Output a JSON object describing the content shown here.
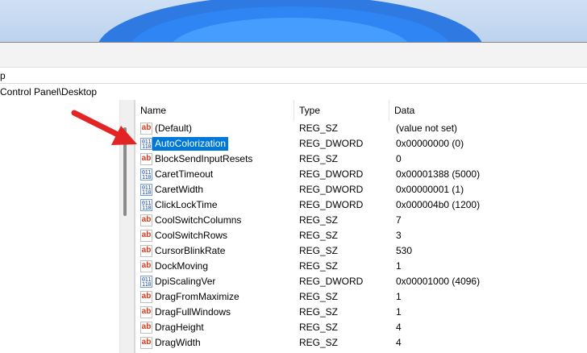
{
  "menu_fragment": "p",
  "address_path": "Control Panel\\Desktop",
  "columns": {
    "name": "Name",
    "type": "Type",
    "data": "Data"
  },
  "values": [
    {
      "icon": "string-value-icon",
      "badge": "ab",
      "name": "(Default)",
      "type": "REG_SZ",
      "data": "(value not set)",
      "selected": false
    },
    {
      "icon": "binary-value-icon",
      "badge": "011\n110",
      "name": "AutoColorization",
      "type": "REG_DWORD",
      "data": "0x00000000 (0)",
      "selected": true
    },
    {
      "icon": "string-value-icon",
      "badge": "ab",
      "name": "BlockSendInputResets",
      "type": "REG_SZ",
      "data": "0",
      "selected": false
    },
    {
      "icon": "binary-value-icon",
      "badge": "011\n110",
      "name": "CaretTimeout",
      "type": "REG_DWORD",
      "data": "0x00001388 (5000)",
      "selected": false
    },
    {
      "icon": "binary-value-icon",
      "badge": "011\n110",
      "name": "CaretWidth",
      "type": "REG_DWORD",
      "data": "0x00000001 (1)",
      "selected": false
    },
    {
      "icon": "binary-value-icon",
      "badge": "011\n110",
      "name": "ClickLockTime",
      "type": "REG_DWORD",
      "data": "0x000004b0 (1200)",
      "selected": false
    },
    {
      "icon": "string-value-icon",
      "badge": "ab",
      "name": "CoolSwitchColumns",
      "type": "REG_SZ",
      "data": "7",
      "selected": false
    },
    {
      "icon": "string-value-icon",
      "badge": "ab",
      "name": "CoolSwitchRows",
      "type": "REG_SZ",
      "data": "3",
      "selected": false
    },
    {
      "icon": "string-value-icon",
      "badge": "ab",
      "name": "CursorBlinkRate",
      "type": "REG_SZ",
      "data": "530",
      "selected": false
    },
    {
      "icon": "string-value-icon",
      "badge": "ab",
      "name": "DockMoving",
      "type": "REG_SZ",
      "data": "1",
      "selected": false
    },
    {
      "icon": "binary-value-icon",
      "badge": "011\n110",
      "name": "DpiScalingVer",
      "type": "REG_DWORD",
      "data": "0x00001000 (4096)",
      "selected": false
    },
    {
      "icon": "string-value-icon",
      "badge": "ab",
      "name": "DragFromMaximize",
      "type": "REG_SZ",
      "data": "1",
      "selected": false
    },
    {
      "icon": "string-value-icon",
      "badge": "ab",
      "name": "DragFullWindows",
      "type": "REG_SZ",
      "data": "1",
      "selected": false
    },
    {
      "icon": "string-value-icon",
      "badge": "ab",
      "name": "DragHeight",
      "type": "REG_SZ",
      "data": "4",
      "selected": false
    },
    {
      "icon": "string-value-icon",
      "badge": "ab",
      "name": "DragWidth",
      "type": "REG_SZ",
      "data": "4",
      "selected": false
    }
  ],
  "colors": {
    "selection": "#0078d7",
    "arrow": "#e32424",
    "ab_icon": "#d83a1d",
    "bin_icon": "#1f4fa8"
  }
}
